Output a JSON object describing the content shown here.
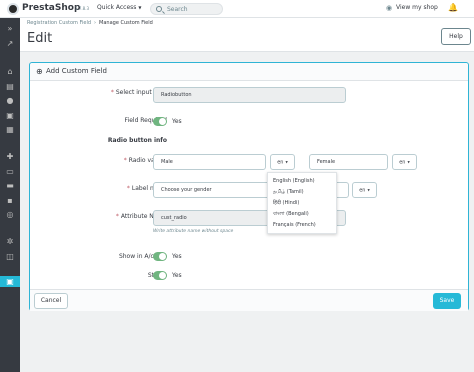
{
  "topbar": {
    "logo": "PrestaShop",
    "version": "1.7.8.3",
    "quick_access": "Quick Access",
    "search_placeholder": "Search",
    "view_shop": "View my shop"
  },
  "breadcrumb": {
    "parent": "Registration Custom Field",
    "current": "Manage Custom Field"
  },
  "header": {
    "title": "Edit",
    "help_label": "Help"
  },
  "card": {
    "title": "Add Custom Field",
    "select_input_type": {
      "label": "Select input type",
      "value": "Radiobutton"
    },
    "field_required": {
      "label": "Field Required",
      "state": "Yes"
    },
    "section_title": "Radio button info",
    "radio_values": {
      "label": "Radio values",
      "value1": "Male",
      "lang1": "en",
      "value2": "Female",
      "lang2": "en"
    },
    "label_name": {
      "label": "Label name",
      "value": "Choose your gender",
      "lang": "en"
    },
    "attribute_name": {
      "label": "Attribute Name",
      "value": "cust_radio",
      "hint": "Write attribute name without space"
    },
    "show_in_account": {
      "label": "Show in A/c info",
      "state": "Yes"
    },
    "status": {
      "label": "Status",
      "state": "Yes"
    },
    "cancel_label": "Cancel",
    "save_label": "Save"
  },
  "language_dropdown": {
    "options": [
      "English (English)",
      "தமிழ் (Tamil)",
      "हिंदी (Hindi)",
      "বাংলা (Bengali)",
      "Français (French)"
    ]
  },
  "colors": {
    "accent": "#25b9d7",
    "switch_on": "#70b580",
    "sidebar": "#363a41",
    "required": "#c05c67"
  }
}
